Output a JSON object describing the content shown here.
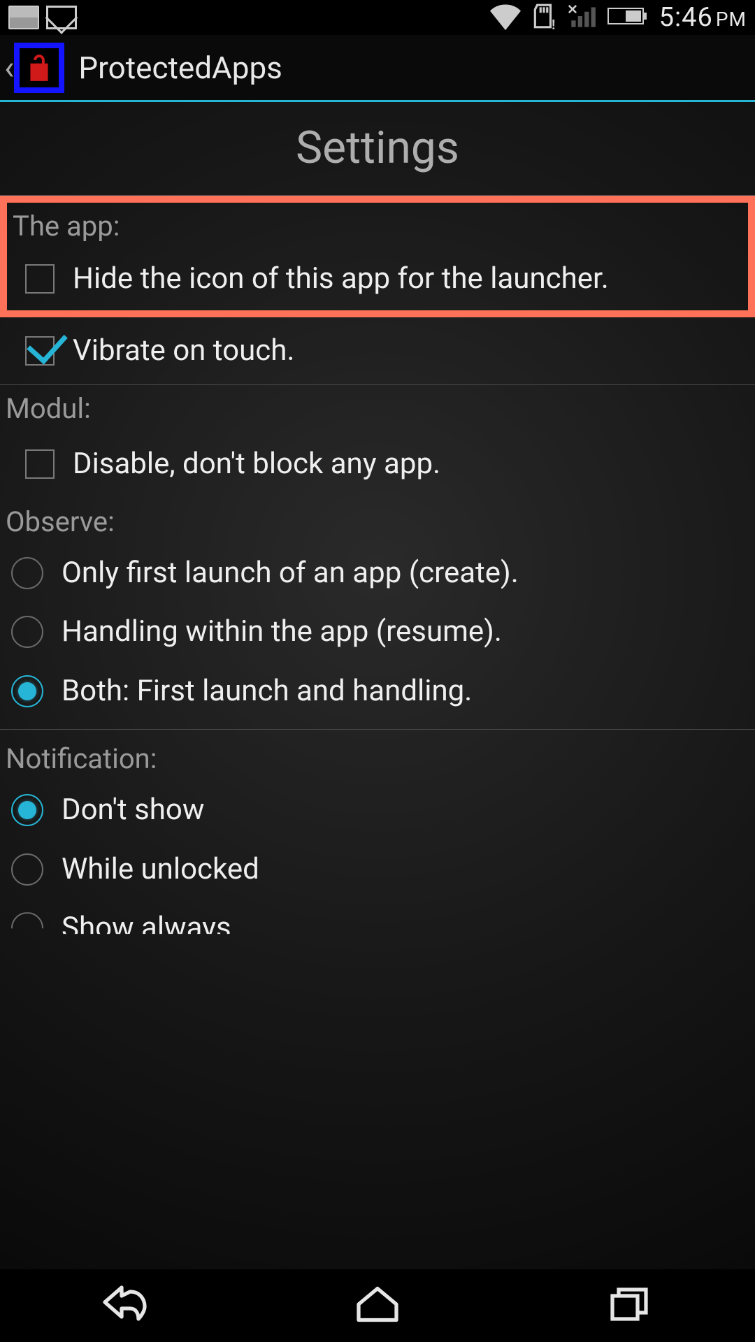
{
  "status": {
    "time": "5:46",
    "ampm": "PM"
  },
  "header": {
    "title": "ProtectedApps"
  },
  "page": {
    "title": "Settings",
    "sections": {
      "app": {
        "label": "The app:",
        "options": [
          {
            "label": "Hide the icon of this app for the launcher.",
            "checked": false
          },
          {
            "label": "Vibrate on touch.",
            "checked": true
          }
        ]
      },
      "modul": {
        "label": "Modul:",
        "options": [
          {
            "label": "Disable, don't block any app.",
            "checked": false
          }
        ]
      },
      "observe": {
        "label": "Observe:",
        "options": [
          {
            "label": "Only first launch of an app (create).",
            "selected": false
          },
          {
            "label": "Handling within the app (resume).",
            "selected": false
          },
          {
            "label": "Both: First launch and handling.",
            "selected": true
          }
        ]
      },
      "notification": {
        "label": "Notification:",
        "options": [
          {
            "label": "Don't show",
            "selected": true
          },
          {
            "label": "While unlocked",
            "selected": false
          },
          {
            "label": "Show always",
            "selected": false
          }
        ]
      }
    }
  },
  "accent_colors": {
    "highlight_border": "#ff7158",
    "accent_blue": "#26b5d6",
    "logo_blue": "#1414ff",
    "lock_red": "#d01919"
  }
}
